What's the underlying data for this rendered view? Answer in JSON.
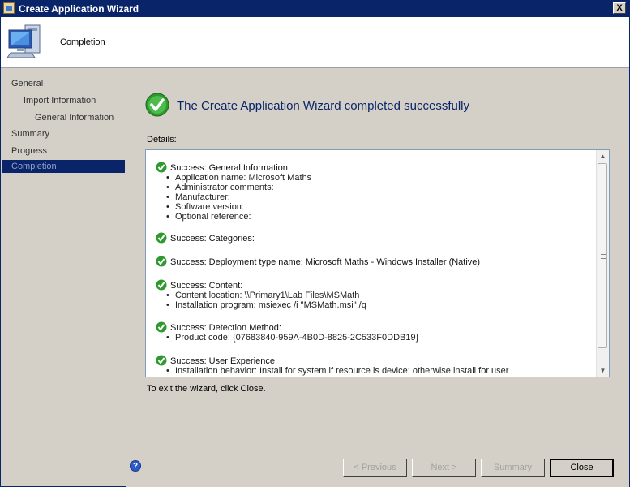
{
  "window": {
    "title": "Create Application Wizard",
    "close_glyph": "X"
  },
  "header": {
    "title": "Completion",
    "icon": "computer-icon"
  },
  "sidebar": {
    "items": [
      {
        "label": "General",
        "indent": 0,
        "active": false
      },
      {
        "label": "Import Information",
        "indent": 1,
        "active": false
      },
      {
        "label": "General Information",
        "indent": 2,
        "active": false
      },
      {
        "label": "Summary",
        "indent": 0,
        "active": false
      },
      {
        "label": "Progress",
        "indent": 0,
        "active": false
      },
      {
        "label": "Completion",
        "indent": 0,
        "active": true
      }
    ]
  },
  "main": {
    "success_title": "The Create Application Wizard completed successfully",
    "details_label": "Details:",
    "exit_text": "To exit the wizard, click Close.",
    "sections": [
      {
        "title": "Success: General Information:",
        "items": [
          "Application name: Microsoft Maths",
          "Administrator comments:",
          "Manufacturer:",
          "Software version:",
          "Optional reference:"
        ]
      },
      {
        "title": "Success: Categories:",
        "items": []
      },
      {
        "title": "Success: Deployment type name: Microsoft Maths - Windows Installer (Native)",
        "items": []
      },
      {
        "title": "Success: Content:",
        "items": [
          "Content location: \\\\Primary1\\Lab Files\\MSMath",
          "Installation program: msiexec /i \"MSMath.msi\" /q"
        ]
      },
      {
        "title": "Success: Detection Method:",
        "items": [
          "Product code: {07683840-959A-4B0D-8825-2C533F0DDB19}"
        ]
      },
      {
        "title": "Success: User Experience:",
        "items": [
          "Installation behavior: Install for system if resource is device; otherwise install for user"
        ]
      }
    ]
  },
  "footer": {
    "help_glyph": "?",
    "buttons": {
      "previous": "< Previous",
      "next": "Next >",
      "summary": "Summary",
      "close": "Close"
    }
  },
  "colors": {
    "titlebar": "#0a246a",
    "success_title": "#0a246a",
    "success_green": "#2e9a2e"
  }
}
